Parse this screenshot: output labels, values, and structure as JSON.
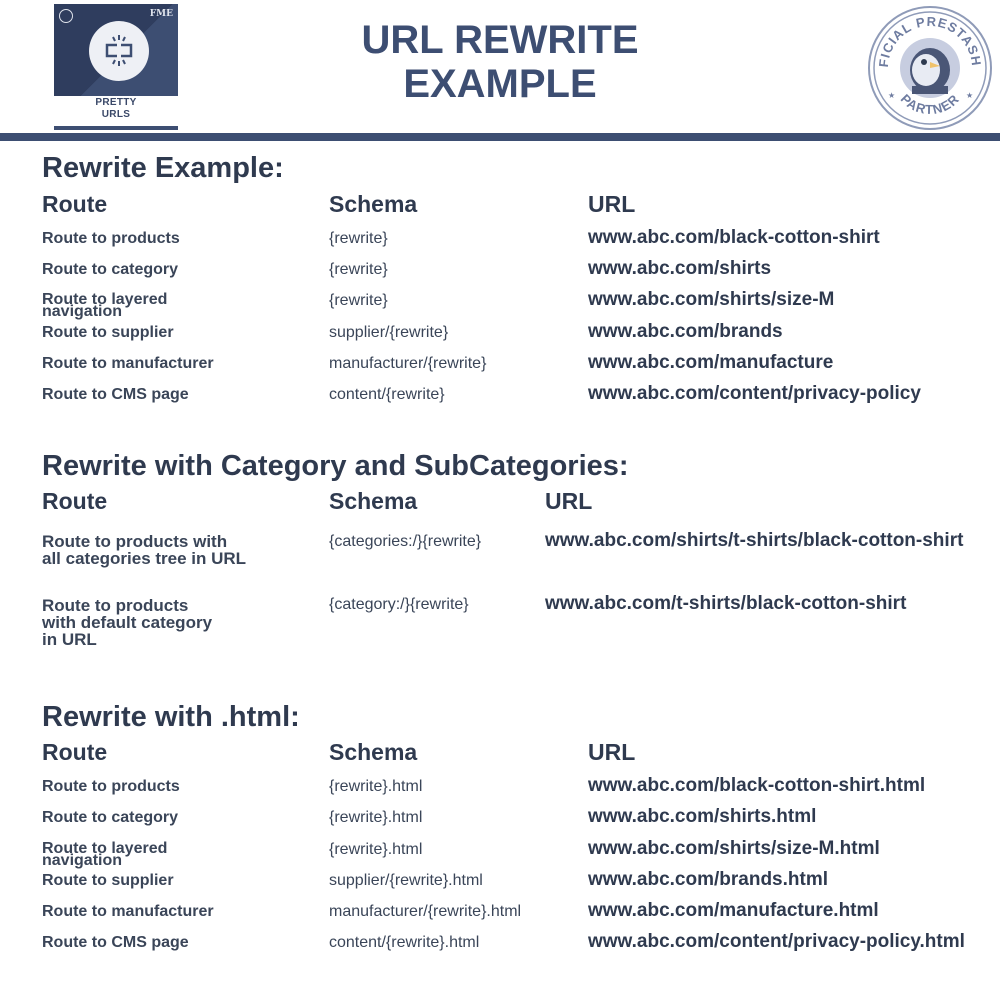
{
  "header": {
    "logo_caption": "PRETTY\nURLS",
    "title_line1": "URL REWRITE",
    "title_line2": "EXAMPLE",
    "badge_top_text": "OFFICIAL PRESTASHOP",
    "badge_bottom_text": "PARTNER",
    "accent_color": "#3d4e72"
  },
  "sections": [
    {
      "title": "Rewrite Example:",
      "columns": [
        "Route",
        "Schema",
        "URL"
      ],
      "rows": [
        {
          "route": "Route to products",
          "schema": "{rewrite}",
          "url": "www.abc.com/black-cotton-shirt"
        },
        {
          "route": "Route to category",
          "schema": "{rewrite}",
          "url": "www.abc.com/shirts"
        },
        {
          "route": "Route to layered\nnavigation",
          "schema": "{rewrite}",
          "url": "www.abc.com/shirts/size-M"
        },
        {
          "route": "Route to supplier",
          "schema": "supplier/{rewrite}",
          "url": "www.abc.com/brands"
        },
        {
          "route": "Route to manufacturer",
          "schema": "manufacturer/{rewrite}",
          "url": "www.abc.com/manufacture"
        },
        {
          "route": "Route to CMS page",
          "schema": "content/{rewrite}",
          "url": "www.abc.com/content/privacy-policy"
        }
      ]
    },
    {
      "title": "Rewrite with Category and SubCategories:",
      "columns": [
        "Route",
        "Schema",
        "URL"
      ],
      "rows": [
        {
          "route": "Route to products with\nall categories tree in URL",
          "schema": "{categories:/}{rewrite}",
          "url": "www.abc.com/shirts/t-shirts/black-cotton-shirt"
        },
        {
          "route": "Route to products\nwith default category\nin URL",
          "schema": "{category:/}{rewrite}",
          "url": "www.abc.com/t-shirts/black-cotton-shirt"
        }
      ]
    },
    {
      "title": "Rewrite with .html:",
      "columns": [
        "Route",
        "Schema",
        "URL"
      ],
      "rows": [
        {
          "route": "Route to products",
          "schema": "{rewrite}.html",
          "url": "www.abc.com/black-cotton-shirt.html"
        },
        {
          "route": "Route to category",
          "schema": "{rewrite}.html",
          "url": "www.abc.com/shirts.html"
        },
        {
          "route": "Route to layered\nnavigation",
          "schema": "{rewrite}.html",
          "url": "www.abc.com/shirts/size-M.html"
        },
        {
          "route": "Route to supplier",
          "schema": "supplier/{rewrite}.html",
          "url": "www.abc.com/brands.html"
        },
        {
          "route": "Route to manufacturer",
          "schema": "manufacturer/{rewrite}.html",
          "url": "www.abc.com/manufacture.html"
        },
        {
          "route": "Route to CMS page",
          "schema": "content/{rewrite}.html",
          "url": "www.abc.com/content/privacy-policy.html"
        }
      ]
    }
  ]
}
